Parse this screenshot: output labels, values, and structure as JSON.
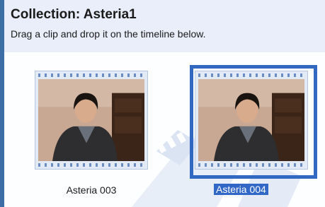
{
  "collection": {
    "title": "Collection: Asteria1",
    "subtitle": "Drag a clip and drop it on the timeline below."
  },
  "clips": [
    {
      "label": "Asteria 003",
      "selected": false,
      "thumbnail": "woman-speaking-thumbnail"
    },
    {
      "label": "Asteria 004",
      "selected": true,
      "thumbnail": "woman-speaking-thumbnail"
    }
  ],
  "colors": {
    "header_bg": "#e9eefa",
    "content_bg": "#fdfeff",
    "selection": "#3068c2",
    "filmstrip": "#e2eaf6",
    "perforation": "#6c8cc4"
  }
}
